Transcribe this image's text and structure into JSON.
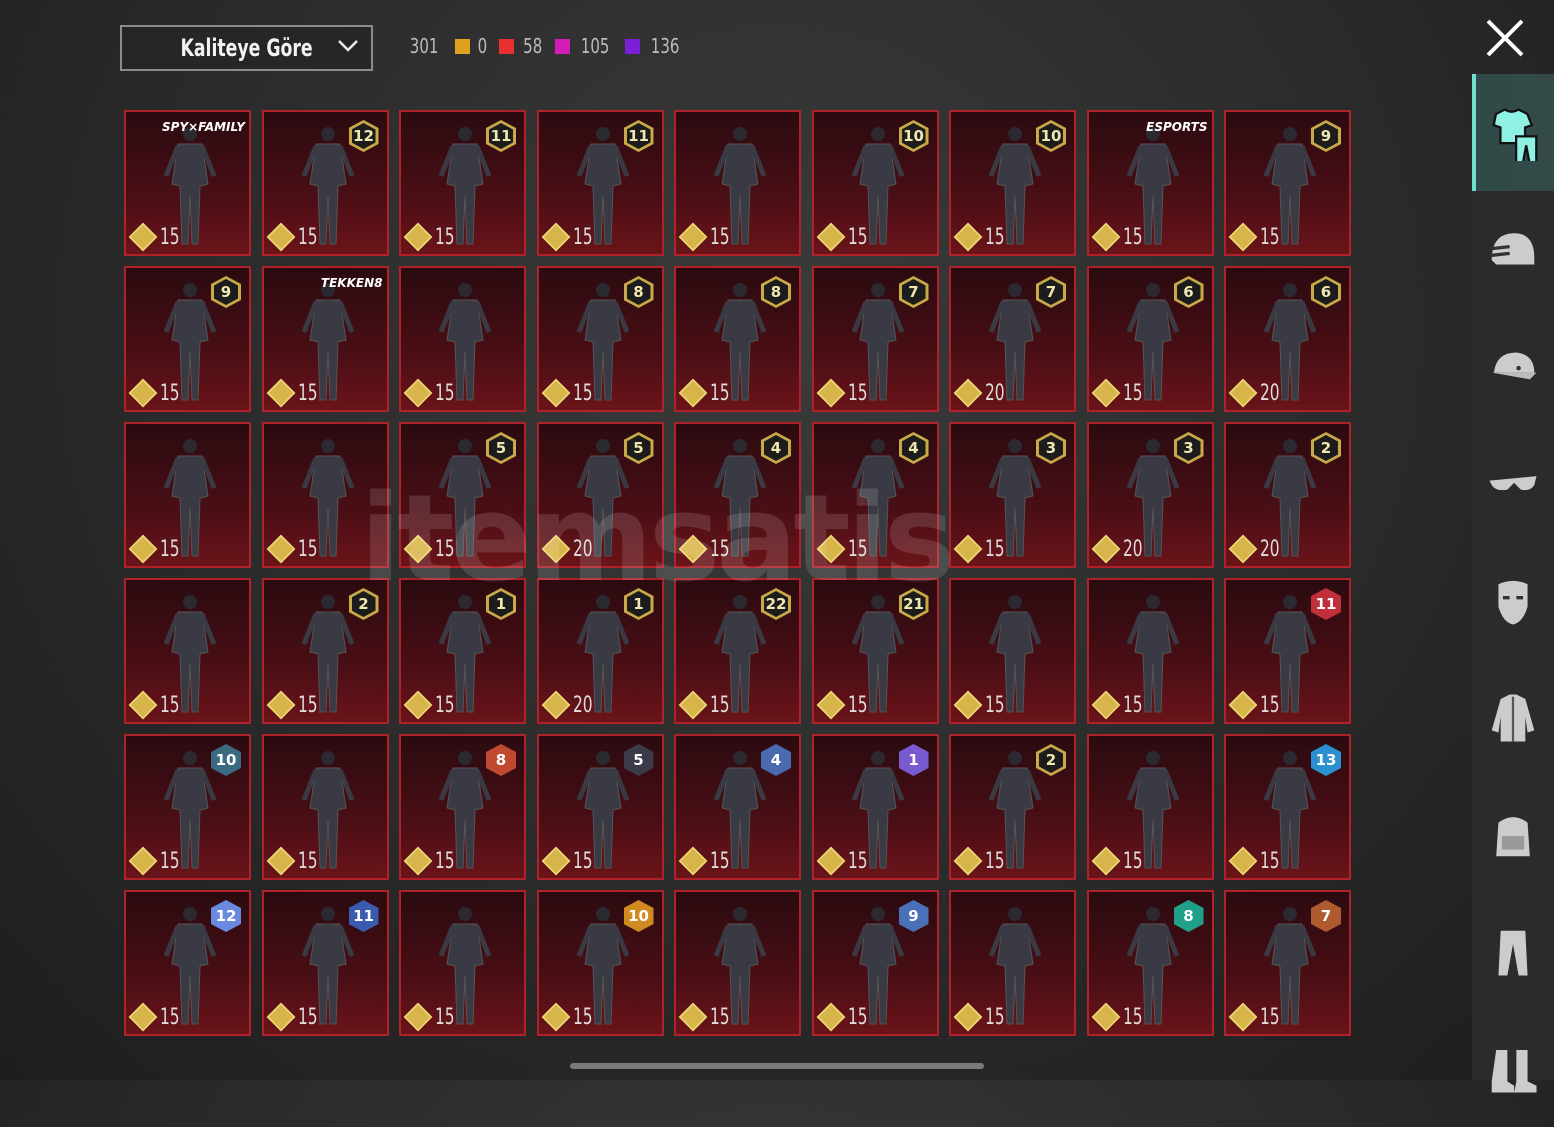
{
  "sort_dropdown": {
    "label": "Kaliteye Göre"
  },
  "stats": {
    "total": "301",
    "counts": [
      {
        "color": "#e0a020",
        "value": "0"
      },
      {
        "color": "#e83030",
        "value": "58"
      },
      {
        "color": "#d21cb8",
        "value": "105"
      },
      {
        "color": "#7a1ed8",
        "value": "136"
      }
    ]
  },
  "watermark": "itemsatis",
  "sidebar": [
    "outfit",
    "helmet",
    "hat",
    "glasses",
    "mask",
    "jacket",
    "backpack",
    "pants",
    "shoes"
  ],
  "items": [
    {
      "tag": "SPY×FAMILY",
      "price": "15"
    },
    {
      "badge": "12",
      "price": "15"
    },
    {
      "badge": "11",
      "price": "15"
    },
    {
      "badge": "11",
      "price": "15"
    },
    {
      "price": "15"
    },
    {
      "badge": "10",
      "price": "15"
    },
    {
      "badge": "10",
      "price": "15"
    },
    {
      "tag": "ESPORTS",
      "price": "15"
    },
    {
      "badge": "9",
      "price": "15"
    },
    {
      "badge": "9",
      "price": "15"
    },
    {
      "tag": "TEKKEN8",
      "price": "15"
    },
    {
      "price": "15"
    },
    {
      "badge": "8",
      "price": "15"
    },
    {
      "badge": "8",
      "price": "15"
    },
    {
      "badge": "7",
      "price": "15"
    },
    {
      "badge": "7",
      "price": "20"
    },
    {
      "badge": "6",
      "price": "15"
    },
    {
      "badge": "6",
      "price": "20"
    },
    {
      "price": "15"
    },
    {
      "price": "15"
    },
    {
      "badge": "5",
      "price": "15"
    },
    {
      "badge": "5",
      "price": "20"
    },
    {
      "badge": "4",
      "price": "15"
    },
    {
      "badge": "4",
      "price": "15"
    },
    {
      "badge": "3",
      "price": "15"
    },
    {
      "badge": "3",
      "price": "20"
    },
    {
      "badge": "2",
      "price": "20"
    },
    {
      "price": "15"
    },
    {
      "badge": "2",
      "price": "15"
    },
    {
      "badge": "1",
      "price": "15"
    },
    {
      "badge": "1",
      "price": "20"
    },
    {
      "badge": "22",
      "price": "15"
    },
    {
      "badge": "21",
      "price": "15"
    },
    {
      "price": "15"
    },
    {
      "price": "15"
    },
    {
      "badge": "11",
      "badge_color": "#c0303a",
      "price": "15"
    },
    {
      "badge": "10",
      "badge_color": "#3a6a80",
      "price": "15"
    },
    {
      "price": "15"
    },
    {
      "badge": "8",
      "badge_color": "#c04a30",
      "price": "15"
    },
    {
      "badge": "5",
      "badge_color": "#3a3a48",
      "price": "15"
    },
    {
      "badge": "4",
      "badge_color": "#4a6ab0",
      "price": "15"
    },
    {
      "badge": "1",
      "badge_color": "#7a5ad0",
      "price": "15"
    },
    {
      "badge": "2",
      "price": "15"
    },
    {
      "price": "15"
    },
    {
      "badge": "13",
      "badge_color": "#2a90d0",
      "price": "15"
    },
    {
      "badge": "12",
      "badge_color": "#6a8ae0",
      "price": "15"
    },
    {
      "badge": "11",
      "badge_color": "#3a5ab0",
      "price": "15"
    },
    {
      "price": "15"
    },
    {
      "badge": "10",
      "badge_color": "#d08a20",
      "price": "15"
    },
    {
      "price": "15"
    },
    {
      "badge": "9",
      "badge_color": "#4a70b8",
      "price": "15"
    },
    {
      "price": "15"
    },
    {
      "badge": "8",
      "badge_color": "#20a088",
      "price": "15"
    },
    {
      "badge": "7",
      "badge_color": "#b05a30",
      "price": "15"
    }
  ]
}
